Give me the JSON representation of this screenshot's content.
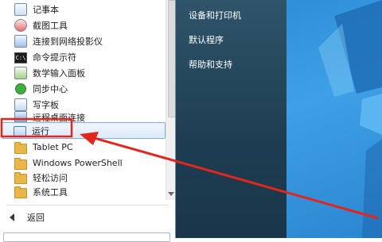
{
  "program_list": [
    {
      "label": "记事本",
      "icon": "notepad-icon"
    },
    {
      "label": "截图工具",
      "icon": "snipping-tool-icon"
    },
    {
      "label": "连接到网络投影仪",
      "icon": "network-projector-icon"
    },
    {
      "label": "命令提示符",
      "icon": "command-prompt-icon"
    },
    {
      "label": "数学输入面板",
      "icon": "math-input-icon"
    },
    {
      "label": "同步中心",
      "icon": "sync-center-icon"
    },
    {
      "label": "写字板",
      "icon": "wordpad-icon"
    },
    {
      "label": "远程桌面连接",
      "icon": "remote-desktop-icon"
    },
    {
      "label": "运行",
      "icon": "run-icon"
    },
    {
      "label": "Tablet PC",
      "icon": "folder-icon"
    },
    {
      "label": "Windows PowerShell",
      "icon": "folder-icon"
    },
    {
      "label": "轻松访问",
      "icon": "folder-icon"
    },
    {
      "label": "系统工具",
      "icon": "folder-icon"
    }
  ],
  "back_label": "返回",
  "right_menu": {
    "devices_printers": "设备和打印机",
    "default_programs": "默认程序",
    "help_support": "帮助和支持"
  },
  "colors": {
    "highlight_box": "#e2261c",
    "arrow": "#e2261c",
    "right_pane": "#2a4b5f",
    "desktop": "#3a9ae0"
  }
}
